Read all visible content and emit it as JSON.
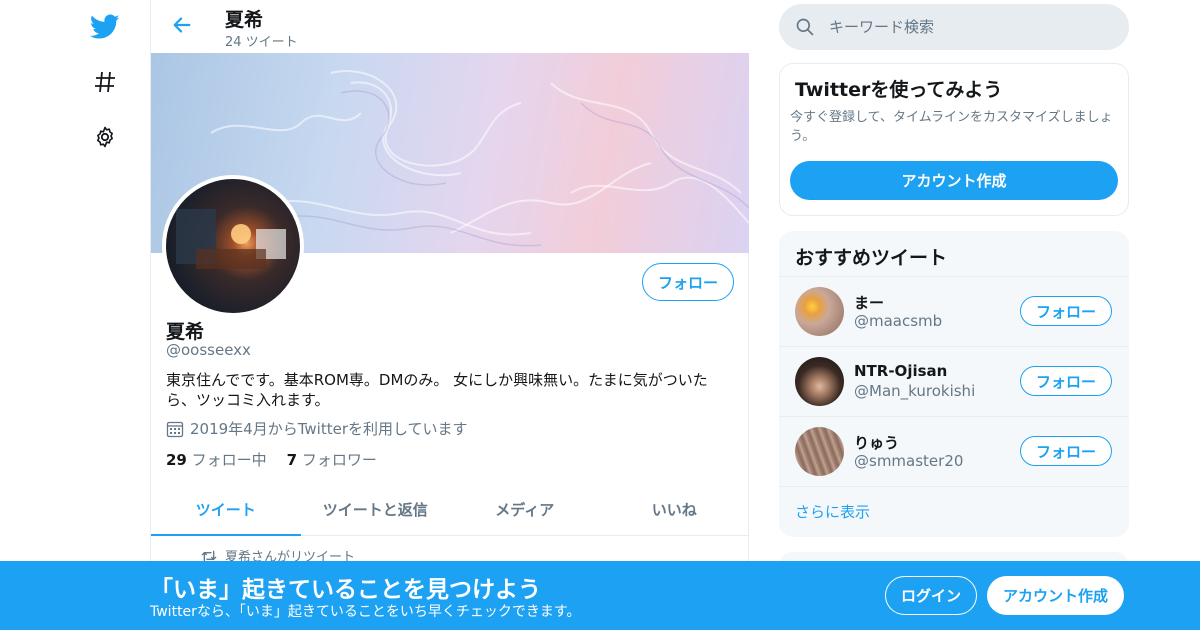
{
  "nav": {
    "logo": "twitter-bird-icon",
    "explore": "hashtag-icon",
    "settings": "gear-icon"
  },
  "header": {
    "name": "夏希",
    "tweet_count": "24 ツイート"
  },
  "profile": {
    "name": "夏希",
    "handle": "@oosseexx",
    "follow_label": "フォロー",
    "bio": "東京住んでです。基本ROM専。DMのみ。 女にしか興味無い。たまに気がついたら、ツッコミ入れます。",
    "joined": "2019年4月からTwitterを利用しています",
    "following_count": "29",
    "following_label": "フォロー中",
    "followers_count": "7",
    "followers_label": "フォロワー"
  },
  "tabs": [
    {
      "label": "ツイート",
      "active": true
    },
    {
      "label": "ツイートと返信",
      "active": false
    },
    {
      "label": "メディア",
      "active": false
    },
    {
      "label": "いいね",
      "active": false
    }
  ],
  "retweet_line": "夏希さんがリツイート",
  "search": {
    "placeholder": "キーワード検索"
  },
  "signup_card": {
    "title": "Twitterを使ってみよう",
    "text": "今すぐ登録して、タイムラインをカスタマイズしましょう。",
    "button": "アカウント作成"
  },
  "recommend": {
    "title": "おすすめツイート",
    "items": [
      {
        "name": "まー",
        "handle": "@maacsmb",
        "follow": "フォロー",
        "avatar_color": "#c9a89a"
      },
      {
        "name": "NTR-Ojisan",
        "handle": "@Man_kurokishi",
        "follow": "フォロー",
        "avatar_color": "#3a2a24"
      },
      {
        "name": "りゅう",
        "handle": "@smmaster20",
        "follow": "フォロー",
        "avatar_color": "#a08070"
      }
    ],
    "more": "さらに表示"
  },
  "bottom_bar": {
    "title": "「いま」起きていることを見つけよう",
    "subtitle": "Twitterなら、「いま」起きていることをいち早くチェックできます。",
    "login": "ログイン",
    "signup": "アカウント作成"
  },
  "colors": {
    "accent": "#1da1f2",
    "text": "#14171a",
    "muted": "#657786"
  }
}
